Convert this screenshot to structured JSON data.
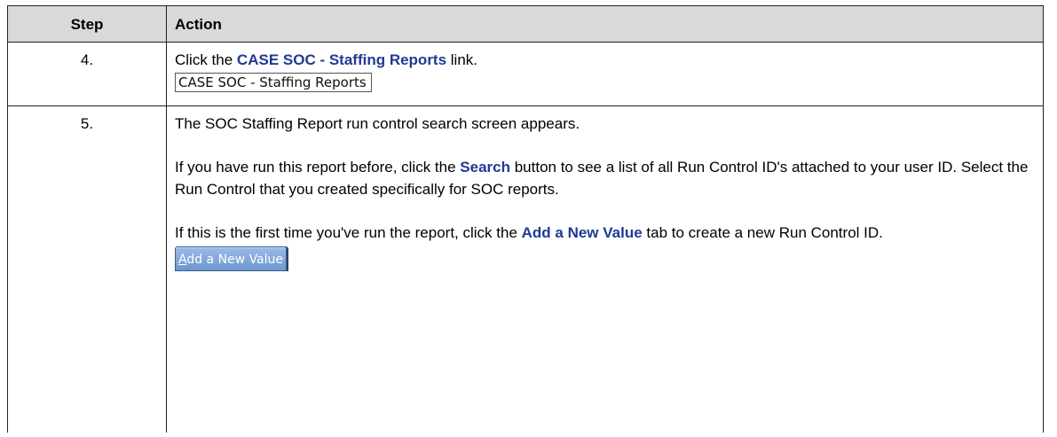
{
  "header": {
    "step": "Step",
    "action": "Action"
  },
  "rows": [
    {
      "step": "4.",
      "text_before": "Click the ",
      "link": "CASE SOC - Staffing Reports",
      "text_after": " link.",
      "ui_label": "CASE SOC - Staffing Reports"
    },
    {
      "step": "5.",
      "para1": "The SOC Staffing Report run control search screen appears.",
      "para2_before": "If you have run this report before, click the ",
      "para2_bold": "Search",
      "para2_after": " button to see a list of all Run Control ID's attached to your user ID.  Select the Run Control that you created specifically for SOC reports.",
      "para3_before": "If this is the first time you've run the report, click the ",
      "para3_bold": "Add a New Value",
      "para3_after": " tab to create a new Run Control ID.",
      "button_first_letter": "A",
      "button_rest": "dd a New Value"
    }
  ],
  "colors": {
    "header_bg": "#d9d9d9",
    "link_text": "#1f3a93",
    "tab_button": "#6d96cf"
  }
}
